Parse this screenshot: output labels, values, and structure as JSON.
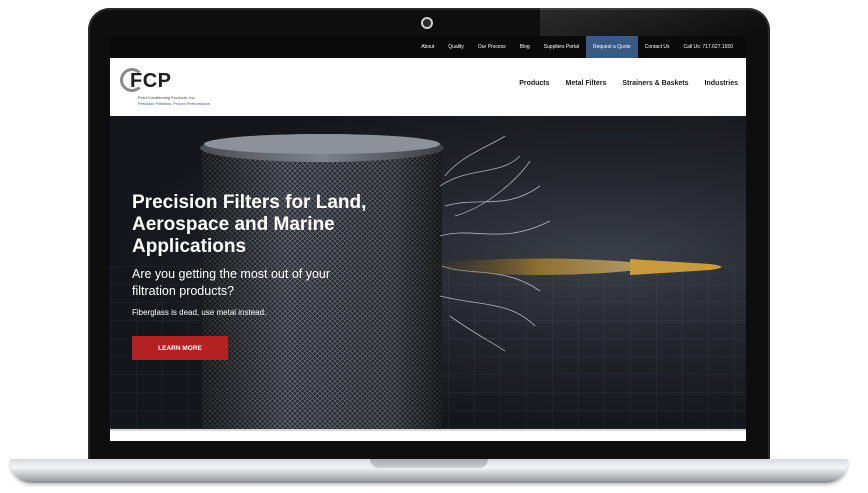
{
  "top_nav": {
    "items": [
      "About",
      "Quality",
      "Our Process",
      "Blog",
      "Suppliers Portal",
      "Request a Quote",
      "Contact Us",
      "Call Us: 717.627.1550"
    ]
  },
  "logo": {
    "text": "FCP",
    "company_name": "Fluid Conditioning Products, Inc.",
    "tagline": "Precision Filtration. Proven Performance."
  },
  "main_nav": {
    "items": [
      "Products",
      "Metal Filters",
      "Strainers & Baskets",
      "Industries"
    ]
  },
  "hero": {
    "title": "Precision Filters for Land, Aerospace and Marine Applications",
    "subtitle": "Are you getting the most out of your filtration products?",
    "note": "Fiberglass is dead, use metal instead.",
    "cta_label": "LEARN MORE"
  },
  "colors": {
    "accent_quote": "#3a5a86",
    "cta": "#b22222",
    "topbar": "#0a0a0a"
  }
}
